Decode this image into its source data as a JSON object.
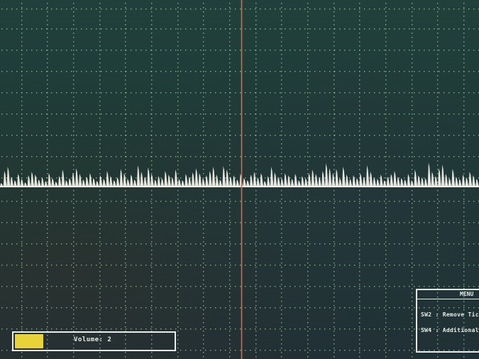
{
  "colors": {
    "grid_dot": "#a8d8a0",
    "trace": "#f2efe8",
    "cursor": "#ff5a2a",
    "volume_fill": "#e8d23a",
    "frame": "#e8eee8"
  },
  "trace": {
    "spike_heights": [
      5,
      22,
      28,
      14,
      9,
      18,
      11,
      6,
      16,
      21,
      17,
      10,
      13,
      8,
      19,
      12,
      7,
      15,
      24,
      9,
      12,
      20,
      26,
      18,
      10,
      14,
      19,
      12,
      8,
      16,
      11,
      22,
      15,
      9,
      13,
      25,
      19,
      11,
      17,
      10,
      30,
      21,
      14,
      27,
      18,
      10,
      15,
      12,
      22,
      17,
      13,
      24,
      11,
      9,
      18,
      14,
      20,
      26,
      19,
      12,
      16,
      22,
      28,
      17,
      10,
      29,
      24,
      14,
      16,
      10,
      18,
      12,
      9,
      17,
      21,
      13,
      19,
      8,
      15,
      28,
      20,
      14,
      12,
      19,
      16,
      11,
      18,
      9,
      15,
      12,
      19,
      24,
      18,
      14,
      22,
      33,
      26,
      19,
      25,
      12,
      28,
      17,
      11,
      16,
      12,
      19,
      14,
      30,
      21,
      13,
      11,
      17,
      9,
      14,
      18,
      22,
      14,
      12,
      10,
      18,
      9,
      24,
      16,
      13,
      12,
      34,
      21,
      15,
      26,
      31,
      18,
      12,
      25,
      14,
      11,
      17,
      13,
      21,
      16,
      11
    ],
    "cursor_x_fraction": 0.505
  },
  "volume": {
    "label": "Volume: 2",
    "level": 0.18
  },
  "menu": {
    "title": "MENU",
    "items": [
      "SW2 : Remove Tic",
      "SW4 : Additional"
    ]
  }
}
